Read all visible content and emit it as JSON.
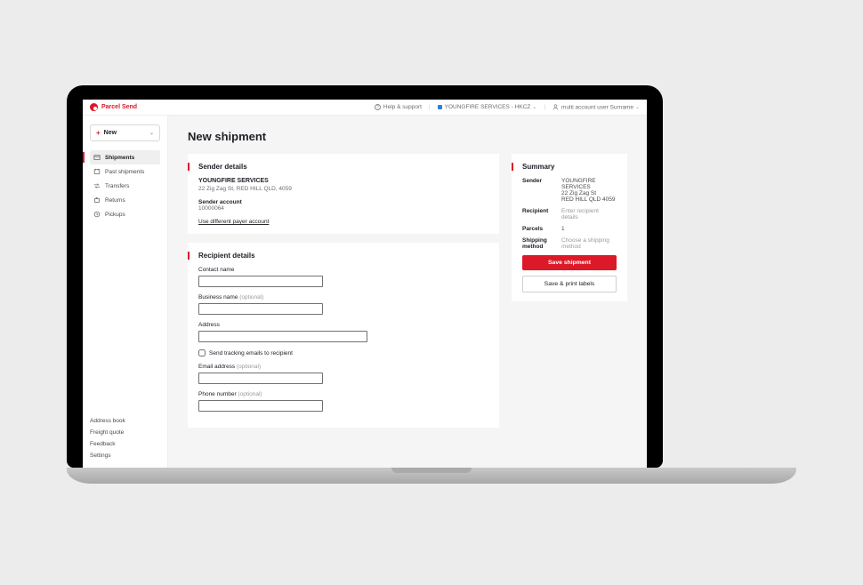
{
  "brand": "Parcel Send",
  "topbar": {
    "help": "Help & support",
    "account": "YOUNGFIRE SERVICES - HKCZ",
    "user": "multi account user Surname"
  },
  "sidebar": {
    "new": "New",
    "items": [
      {
        "label": "Shipments"
      },
      {
        "label": "Past shipments"
      },
      {
        "label": "Transfers"
      },
      {
        "label": "Returns"
      },
      {
        "label": "Pickups"
      }
    ],
    "bottom": [
      "Address book",
      "Freight quote",
      "Feedback",
      "Settings"
    ]
  },
  "page": {
    "title": "New shipment"
  },
  "sender": {
    "heading": "Sender details",
    "name": "YOUNGFIRE SERVICES",
    "address": "22 Zig Zag St, RED HILL QLD, 4059",
    "account_label": "Sender account",
    "account_number": "10000064",
    "link": "Use different payer account"
  },
  "recipient": {
    "heading": "Recipient details",
    "contact_label": "Contact name",
    "business_label": "Business name",
    "address_label": "Address",
    "tracking_label": "Send tracking emails to recipient",
    "email_label": "Email address",
    "phone_label": "Phone number",
    "optional": "(optional)"
  },
  "summary": {
    "heading": "Summary",
    "rows": {
      "sender_k": "Sender",
      "sender_name": "YOUNGFIRE SERVICES",
      "sender_a1": "22 Zig Zag St",
      "sender_a2": "RED HILL QLD 4059",
      "recipient_k": "Recipient",
      "recipient_v": "Enter recipient details",
      "parcels_k": "Parcels",
      "parcels_v": "1",
      "method_k": "Shipping method",
      "method_v": "Choose a shipping method"
    },
    "save": "Save shipment",
    "print": "Save & print labels"
  }
}
